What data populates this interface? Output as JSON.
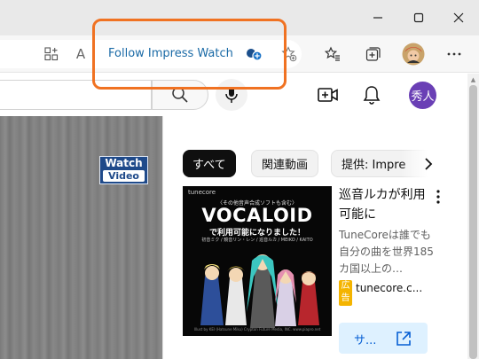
{
  "browser": {
    "follow_label": "Follow Impress Watch",
    "address_icon_read": "A"
  },
  "youtube": {
    "avatar_initials": "秀人",
    "brand_logo": {
      "line1": "Watch",
      "line2": "Video"
    },
    "chips": {
      "all": "すべて",
      "related": "関連動画",
      "provided_by": "提供: Impre"
    },
    "ad": {
      "thumbnail": {
        "brand": "tunecore",
        "small_caption": "〈その他音声合成ソフトも含む〉",
        "headline": "VOCALOID",
        "subheadline": "で利用可能になりました！",
        "names": "初音ミク / 鏡音リン・レン / 巡音ルカ / MEIKO / KAITO",
        "footer": "Illust by KEI (Hatsune Miku) Crypton Future Media, INC. www.piapro.net"
      },
      "title": "巡音ルカが利用可能に",
      "description": "TuneCoreは誰でも自分の曲を世界185カ国以上の…",
      "badge": "広告",
      "domain": "tunecore.c...",
      "cta_label": "サ..."
    }
  },
  "colors": {
    "highlight_border": "#f07222",
    "follow_text": "#1a6aa6",
    "avatar_bg": "#6a3fb5",
    "cta_bg": "#def1ff",
    "ad_badge_bg": "#f4b400"
  }
}
